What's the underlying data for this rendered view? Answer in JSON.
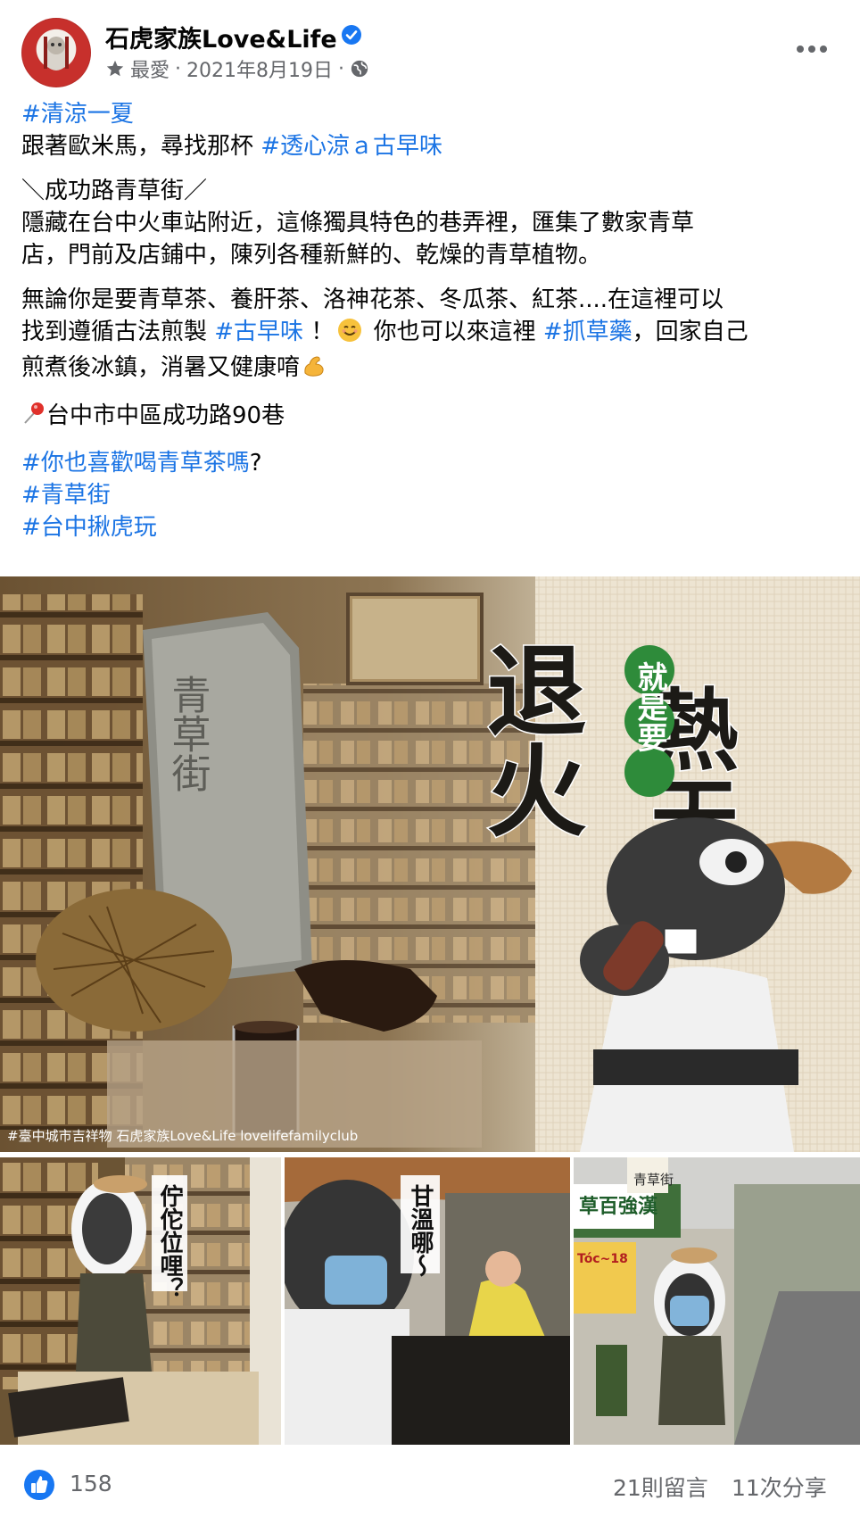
{
  "post": {
    "page_name": "石虎家族Love&Life",
    "meta_favorite": "最愛",
    "meta_sep": "·",
    "date": "2021年8月19日",
    "meta_sep2": "·",
    "icons": [
      "star-icon",
      "globe-icon",
      "verified-badge-icon",
      "more-options-icon"
    ]
  },
  "text": {
    "l1_tag": "#清涼一夏",
    "l2_text": "跟著歐米馬，尋找那杯 ",
    "l2_tag": "#透心涼ａ古早味",
    "l3": "＼成功路青草街／",
    "l4": "隱藏在台中火車站附近，這條獨具特色的巷弄裡，匯集了數家青草",
    "l5": "店，門前及店鋪中，陳列各種新鮮的、乾燥的青草植物。",
    "l6": "無論你是要青草茶、養肝茶、洛神花茶、冬瓜茶、紅茶....在這裡可以",
    "l7_a": "找到遵循古法煎製 ",
    "l7_tag1": "#古早味",
    "l7_b": " ！",
    "l7_c": " 你也可以來這裡 ",
    "l7_tag2": "#抓草藥",
    "l7_d": "，回家自己",
    "l8": "煎煮後冰鎮，消暑又健康唷",
    "l9": "台中市中區成功路90巷",
    "l10_tag": "#你也喜歡喝青草茶嗎",
    "l10_q": "?",
    "l11_tag": "#青草街",
    "l12_tag": "#台中揪虎玩"
  },
  "images": {
    "main_title_a": "熱天",
    "main_title_b": "就是要",
    "main_title_c": "退火",
    "sign_text": "青草街",
    "main_watermark": "#臺中城市吉祥物  石虎家族Love&Life  lovelifefamilyclub",
    "thumb1_caption": "佇佗位哩？",
    "thumb2_caption": "甘溫哪～",
    "thumb3_sign1": "青草街",
    "thumb3_sign2": "草百強漢",
    "thumb3_sign3": "Tóc~18"
  },
  "footer": {
    "reactions": "158",
    "comments": "21則留言",
    "shares": "11次分享"
  },
  "colors": {
    "hashtag": "#1b74e4",
    "secondary_text": "#65676b",
    "like_blue": "#1877f2",
    "title_green": "#2e8b3a"
  }
}
